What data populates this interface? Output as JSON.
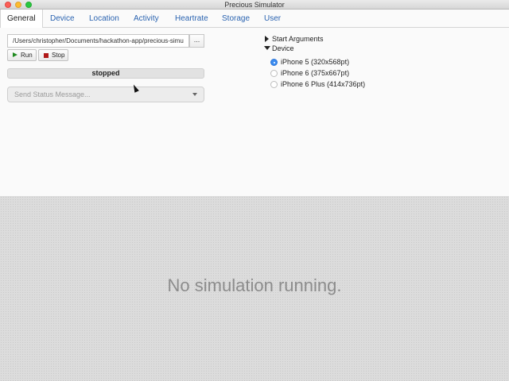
{
  "window": {
    "title": "Precious Simulator"
  },
  "tabs": [
    {
      "label": "General"
    },
    {
      "label": "Device"
    },
    {
      "label": "Location"
    },
    {
      "label": "Activity"
    },
    {
      "label": "Heartrate"
    },
    {
      "label": "Storage"
    },
    {
      "label": "User"
    }
  ],
  "general": {
    "app_path": "/Users/christopher/Documents/hackathon-app/precious-simu",
    "browse_label": "...",
    "run_label": "Run",
    "stop_label": "Stop",
    "status": "stopped",
    "message_placeholder": "Send Status Message..."
  },
  "options": {
    "start_arguments_label": "Start Arguments",
    "device_label": "Device",
    "devices": [
      {
        "label": "iPhone 5 (320x568pt)",
        "selected": true
      },
      {
        "label": "iPhone 6 (375x667pt)",
        "selected": false
      },
      {
        "label": "iPhone 6 Plus (414x736pt)",
        "selected": false
      }
    ]
  },
  "simulator": {
    "message": "No simulation running."
  },
  "colors": {
    "accent": "#3b8cf0",
    "tab_link": "#2a63b0",
    "run_green": "#1e8a1e",
    "stop_red": "#b01818"
  }
}
